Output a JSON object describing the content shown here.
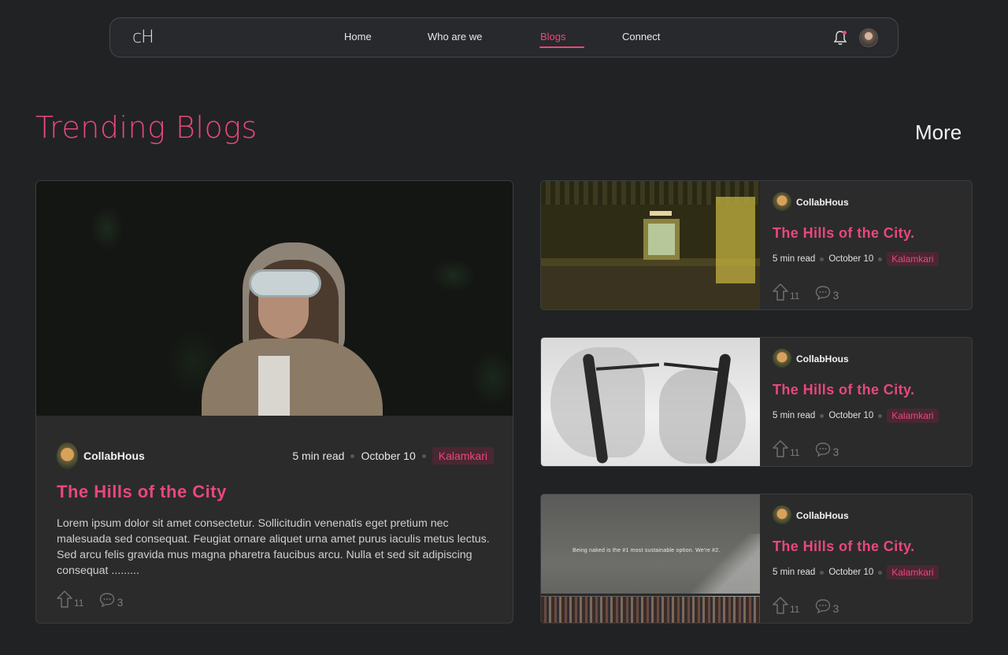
{
  "nav": {
    "logo": "cH",
    "links": [
      "Home",
      "Who are we",
      "Blogs",
      "Connect"
    ],
    "active": "Blogs"
  },
  "section": {
    "title": "Trending Blogs",
    "more": "More"
  },
  "colors": {
    "accent": "#e8487a",
    "background": "#212224",
    "card": "#2b2b2c"
  },
  "featured": {
    "author": "CollabHous",
    "read_time": "5 min read",
    "date": "October 10",
    "tag": "Kalamkari",
    "title": "The Hills of the City",
    "excerpt": "Lorem ipsum dolor sit amet consectetur. Sollicitudin venenatis eget pretium nec malesuada sed consequat. Feugiat ornare aliquet urna amet purus iaculis metus lectus. Sed arcu felis gravida mus magna pharetra faucibus arcu. Nulla et sed sit adipiscing consequat .........",
    "upvotes": "11",
    "comments": "3"
  },
  "side_posts": [
    {
      "author": "CollabHous",
      "title": "The Hills of the City.",
      "read_time": "5 min read",
      "date": "October 10",
      "tag": "Kalamkari",
      "upvotes": "11",
      "comments": "3"
    },
    {
      "author": "CollabHous",
      "title": "The Hills of the City.",
      "read_time": "5 min read",
      "date": "October 10",
      "tag": "Kalamkari",
      "upvotes": "11",
      "comments": "3"
    },
    {
      "author": "CollabHous",
      "title": "The Hills of the City.",
      "read_time": "5 min read",
      "date": "October 10",
      "tag": "Kalamkari",
      "upvotes": "11",
      "comments": "3",
      "image_caption": "Being naked is the #1 most sustainable option. We're #2."
    }
  ]
}
